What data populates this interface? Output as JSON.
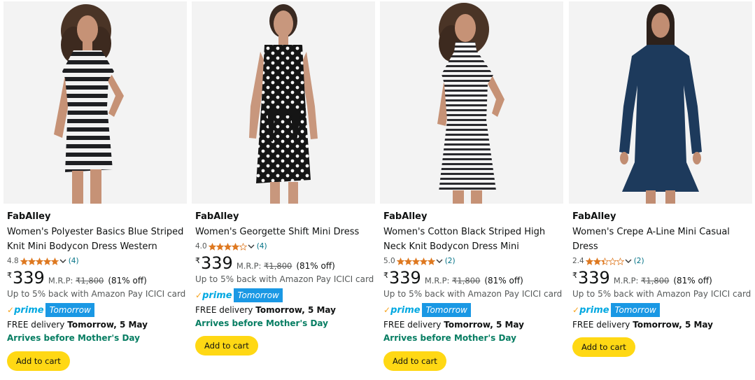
{
  "products": [
    {
      "brand": "FabAlley",
      "title": "Women's Polyester Basics Blue Striped Knit Mini Bodycon Dress Western",
      "rating": "4.8",
      "rating_stars": 4.8,
      "review_count": "(4)",
      "currency": "₹",
      "price": "339",
      "mrp_label": "M.R.P:",
      "mrp_value": "₹1,800",
      "discount": "(81% off)",
      "cashback": "Up to 5% back with Amazon Pay ICICI card",
      "prime_label": "prime",
      "prime_tag": "Tomorrow",
      "delivery_prefix": "FREE delivery",
      "delivery_date": "Tomorrow, 5 May",
      "arrives": "Arrives before Mother's Day",
      "add_to_cart": "Add to cart",
      "image": "striped-dress-short-sleeve"
    },
    {
      "brand": "FabAlley",
      "title": "Women's Georgette Shift Mini Dress",
      "rating": "4.0",
      "rating_stars": 4.0,
      "review_count": "(4)",
      "currency": "₹",
      "price": "339",
      "mrp_label": "M.R.P:",
      "mrp_value": "₹1,800",
      "discount": "(81% off)",
      "cashback": "Up to 5% back with Amazon Pay ICICI card",
      "prime_label": "prime",
      "prime_tag": "Tomorrow",
      "delivery_prefix": "FREE delivery",
      "delivery_date": "Tomorrow, 5 May",
      "arrives": "Arrives before Mother's Day",
      "add_to_cart": "Add to cart",
      "image": "polka-dot-dress-sleeveless"
    },
    {
      "brand": "FabAlley",
      "title": "Women's Cotton Black Striped High Neck Knit Bodycon Dress Mini",
      "rating": "5.0",
      "rating_stars": 5.0,
      "review_count": "(2)",
      "currency": "₹",
      "price": "339",
      "mrp_label": "M.R.P:",
      "mrp_value": "₹1,800",
      "discount": "(81% off)",
      "cashback": "Up to 5% back with Amazon Pay ICICI card",
      "prime_label": "prime",
      "prime_tag": "Tomorrow",
      "delivery_prefix": "FREE delivery",
      "delivery_date": "Tomorrow, 5 May",
      "arrives": "Arrives before Mother's Day",
      "add_to_cart": "Add to cart",
      "image": "thin-striped-dress-high-neck"
    },
    {
      "brand": "FabAlley",
      "title": "Women's Crepe A-Line Mini Casual Dress",
      "rating": "2.4",
      "rating_stars": 2.4,
      "review_count": "(2)",
      "currency": "₹",
      "price": "339",
      "mrp_label": "M.R.P:",
      "mrp_value": "₹1,800",
      "discount": "(81% off)",
      "cashback": "Up to 5% back with Amazon Pay ICICI card",
      "prime_label": "prime",
      "prime_tag": "Tomorrow",
      "delivery_prefix": "FREE delivery",
      "delivery_date": "Tomorrow, 5 May",
      "add_to_cart": "Add to cart",
      "image": "navy-long-sleeve-dress"
    }
  ],
  "colors": {
    "star": "#de7921",
    "link": "#007185",
    "green": "#067d62",
    "prime_blue": "#1a98e4",
    "cart_yellow": "#ffd814"
  }
}
